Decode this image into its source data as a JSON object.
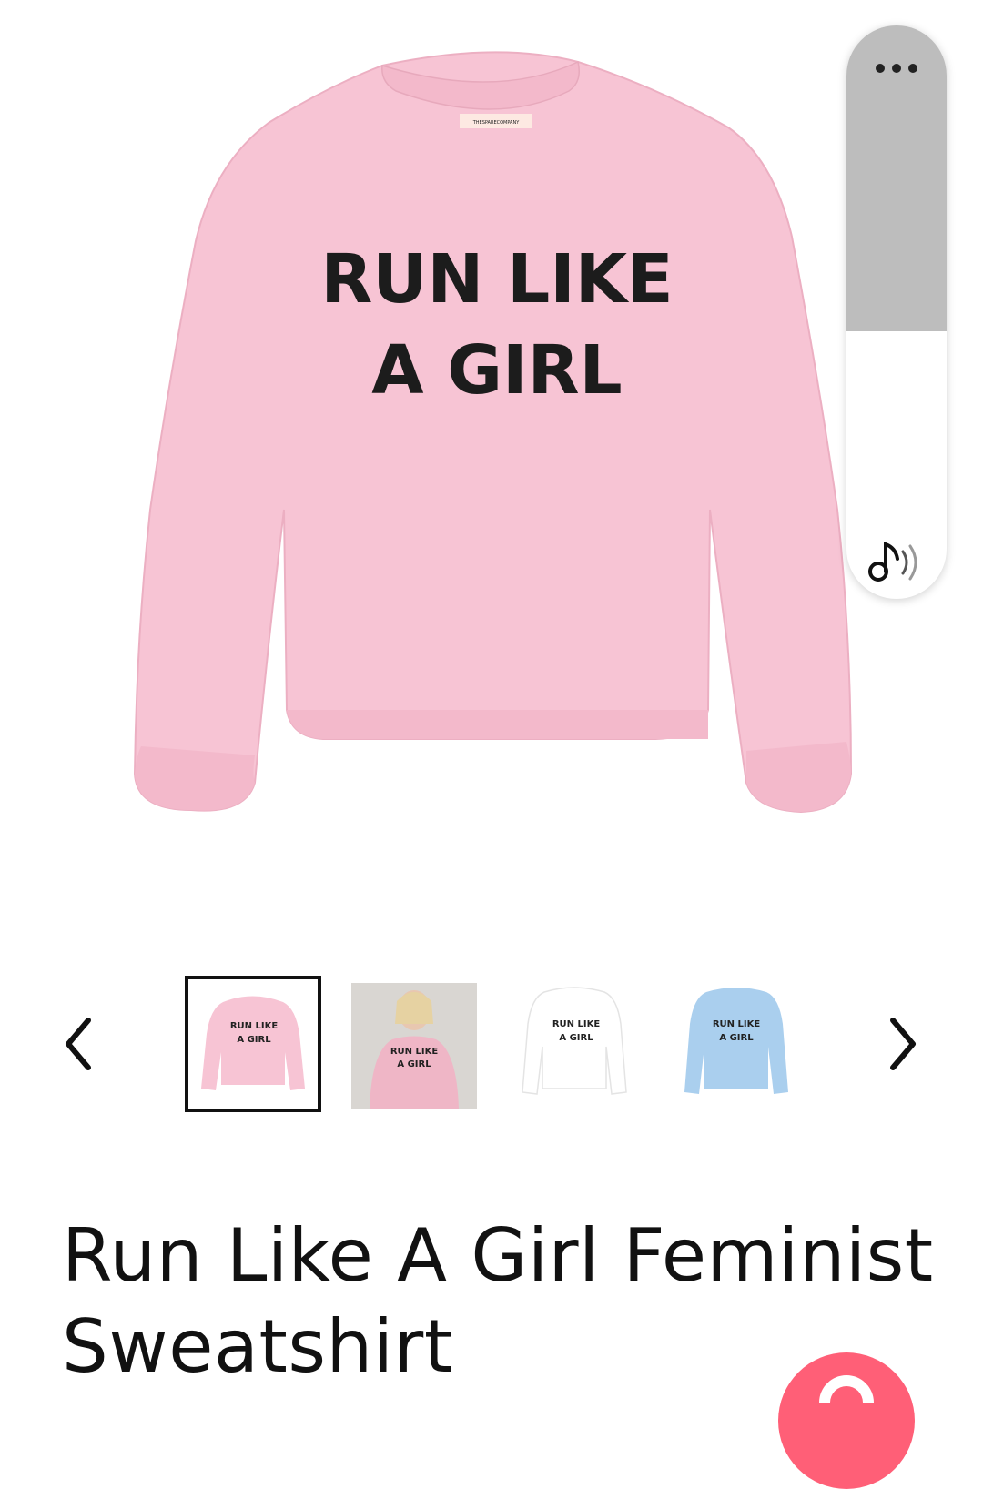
{
  "product": {
    "title": "Run Like A Girl Feminist Sweatshirt",
    "print_line1": "RUN LIKE",
    "print_line2": "A GIRL",
    "brand_label": "THESPARECOMPANY",
    "main_color": "#f7c4d4"
  },
  "gallery": {
    "prev_icon": "chevron-left-icon",
    "next_icon": "chevron-right-icon",
    "thumbnails": [
      {
        "name": "pink sweatshirt",
        "line1": "RUN LIKE",
        "line2": "A GIRL",
        "color": "#f7c4d4",
        "selected": true
      },
      {
        "name": "model pink sweatshirt",
        "line1": "RUN LIKE",
        "line2": "A GIRL",
        "color": "#efb6c6",
        "selected": false
      },
      {
        "name": "white sweatshirt",
        "line1": "RUN LIKE",
        "line2": "A GIRL",
        "color": "#ffffff",
        "selected": false
      },
      {
        "name": "blue sweatshirt",
        "line1": "RUN LIKE",
        "line2": "A GIRL",
        "color": "#aacfee",
        "selected": false
      }
    ]
  },
  "widget": {
    "menu_icon": "more-dots-icon",
    "audio_icon": "music-note-sound-icon"
  },
  "wishlist": {
    "icon": "heart-icon",
    "color": "#ff5f77"
  }
}
